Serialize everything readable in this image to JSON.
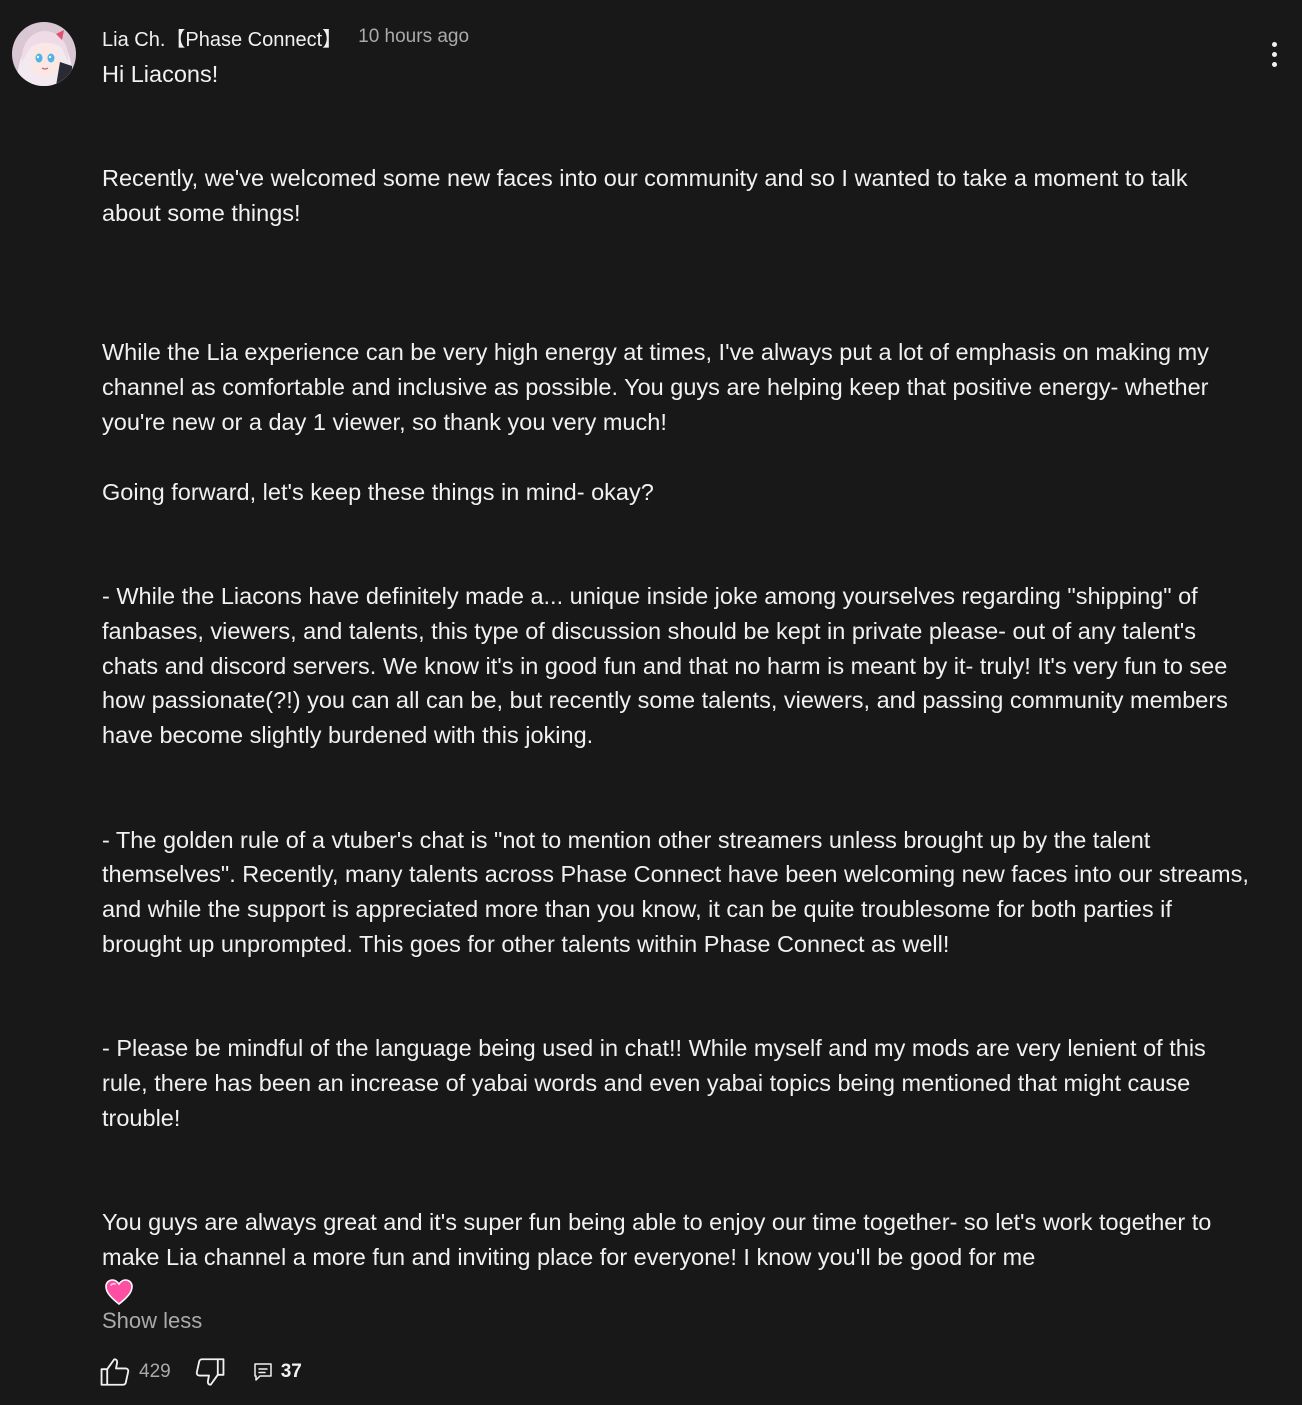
{
  "comment": {
    "author": "Lia Ch.【Phase Connect】",
    "timestamp": "10 hours ago",
    "avatar_icon": "anime-girl-avatar",
    "menu_icon": "more-vert-icon",
    "body": "Hi Liacons!\n\n\nRecently, we've welcomed some new faces into our community and so I wanted to take a moment to talk about some things!\n\n\n\nWhile the Lia experience can be very high energy at times, I've always put a lot of emphasis on making my channel as comfortable and inclusive as possible. You guys are helping keep that positive energy- whether you're new or a day 1 viewer, so thank you very much!\n\nGoing forward, let's keep these things in mind- okay?\n\n\n- While the Liacons have definitely made a... unique inside joke among yourselves regarding \"shipping\" of fanbases, viewers, and talents, this type of discussion should be kept in private please- out of any talent's chats and discord servers. We know it's in good fun and that no harm is meant by it- truly! It's very fun to see how passionate(?!) you can all can be, but recently some talents, viewers, and passing community members have become slightly burdened with this joking.\n\n\n- The golden rule of a vtuber's chat is \"not to mention other streamers unless brought up by the talent themselves\". Recently, many talents across Phase Connect have been welcoming new faces into our streams, and while the support is appreciated more than you know, it can be quite troublesome for both parties if brought up unprompted. This goes for other talents within Phase Connect as well!\n\n\n- Please be mindful of the language being used in chat!! While myself and my mods are very lenient of this rule, there has been an increase of yabai words and even yabai topics being mentioned that might cause trouble!\n\n\nYou guys are always great and it's super fun being able to enjoy our time together- so let's work together to make Lia channel a more fun and inviting place for everyone! I know you'll be good for me",
    "emoji": "pink-heart-emoji",
    "show_less_label": "Show less",
    "likes": "429",
    "replies": "37",
    "like_icon": "thumb-up-icon",
    "dislike_icon": "thumb-down-icon",
    "reply_icon": "reply-comment-icon"
  },
  "colors": {
    "background": "#181818",
    "text_primary": "#f1f1f1",
    "text_secondary": "#aaaaaa",
    "heart": "#ff4fa3"
  }
}
